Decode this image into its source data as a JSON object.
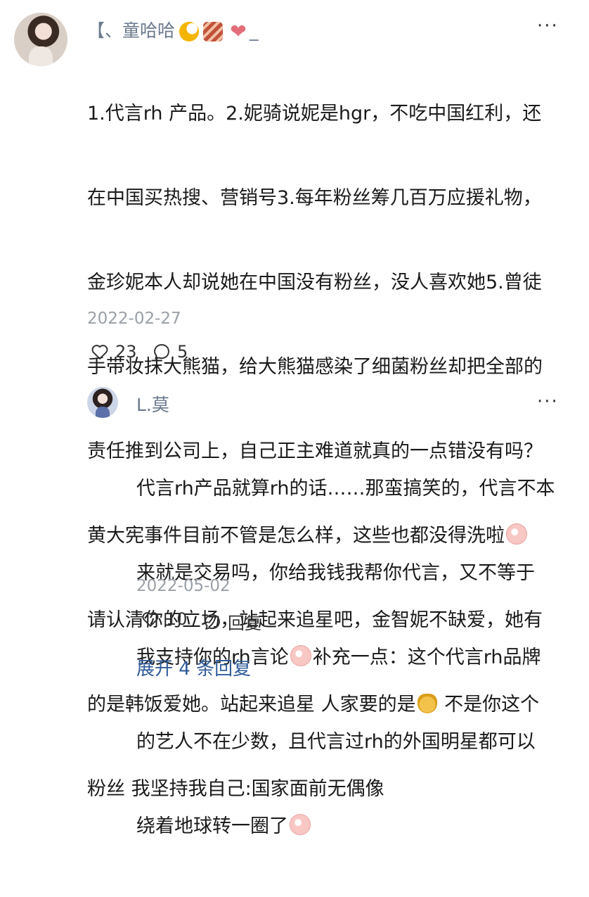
{
  "main_comment": {
    "username": "【、童哈哈",
    "username_suffix": "_",
    "more": "···",
    "text_lines": [
      "1.代言rh 产品。2.妮骑说妮是hgr，不吃中国红利，还",
      "在中国买热搜、营销号3.每年粉丝筹几百万应援礼物，",
      "金珍妮本人却说她在中国没有粉丝，没人喜欢她5.曾徒",
      "手带妆抹大熊猫，给大熊猫感染了细菌粉丝却把全部的",
      "责任推到公司上，自己正主难道就真的一点错没有吗？",
      "黄大宪事件目前不管是怎么样，这些也都没得洗啦",
      "请认清你的立场，站起来追星吧，金智妮不缺爱，她有",
      "的是韩饭爱她。站起来追星 人家要的是",
      " 不是你这个",
      "粉丝 我坚持我自己:国家面前无偶像"
    ],
    "date": "2022-02-27",
    "likes": "23",
    "comments": "5"
  },
  "reply": {
    "username": "L.莫",
    "more": "···",
    "text_lines": [
      "代言rh产品就算rh的话……那蛮搞笑的，代言不本",
      "来就是交易吗，你给我钱我帮你代言，又不等于",
      "我支持你的rh言论",
      "补充一点：这个代言rh品牌",
      "的艺人不在少数，且代言过rh的外国明星都可以",
      "绕着地球转一圈了"
    ],
    "date": "2022-05-02",
    "likes": "10",
    "reply_label": "回复"
  },
  "expand_label": "展开 4 条回复",
  "icons": {
    "heart": "heart-outline-icon",
    "comment": "speech-bubble-icon"
  },
  "colors": {
    "username": "#6b7a8f",
    "date": "#9aa0a8",
    "link": "#2f5b9a"
  }
}
